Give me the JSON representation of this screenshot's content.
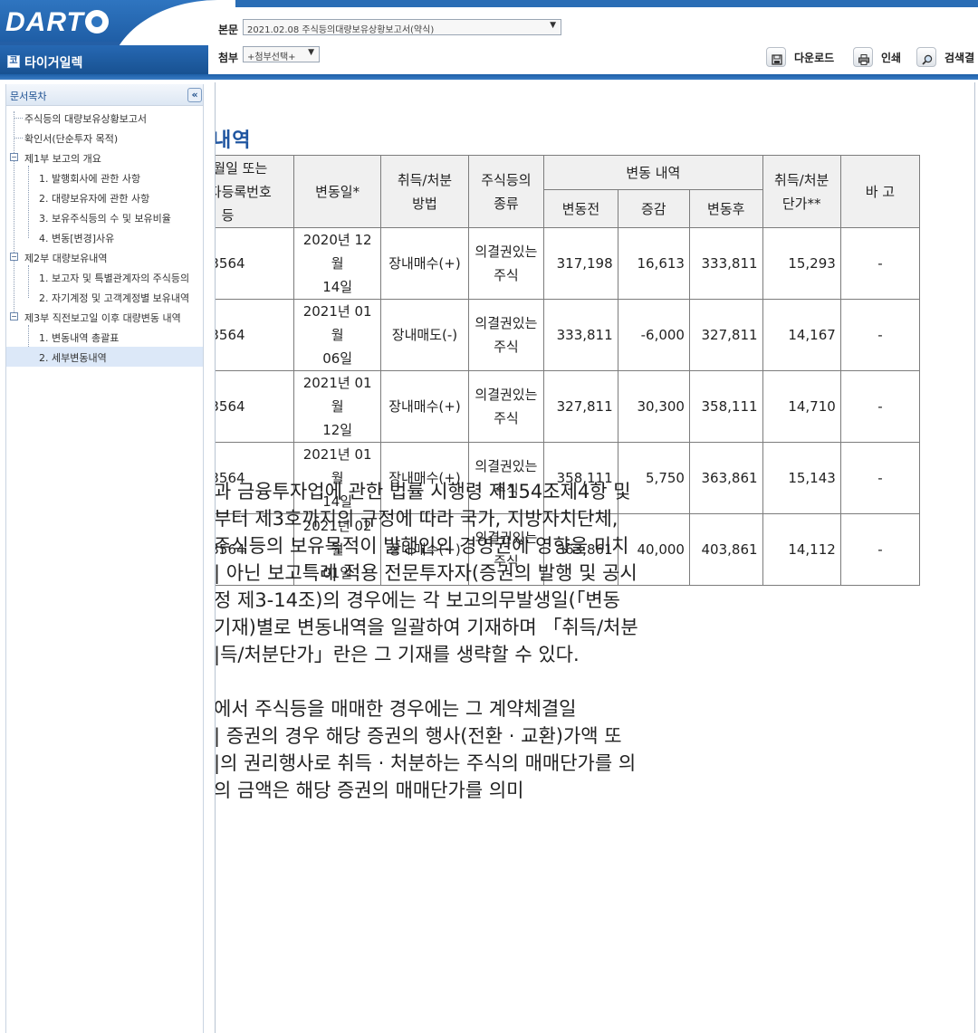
{
  "app": {
    "logo": "DART",
    "company": "타이거일렉",
    "company_icon": "코"
  },
  "header": {
    "body_label": "본문",
    "body_select": "2021.02.08 주식등의대량보유상황보고서(약식)",
    "attach_label": "첨부",
    "attach_select": "+첨부선택+",
    "download": "다운로드",
    "print": "인쇄",
    "search": "검색결"
  },
  "sidebar": {
    "title": "문서목차",
    "collapse": "«",
    "items": [
      {
        "label": "주식등의 대량보유상황보고서"
      },
      {
        "label": "확인서(단순투자 목적)"
      },
      {
        "label": "제1부 보고의 개요"
      },
      {
        "label": "1. 발행회사에 관한 사항"
      },
      {
        "label": "2. 대량보유자에 관한 사항"
      },
      {
        "label": "3. 보유주식등의 수 및 보유비율"
      },
      {
        "label": "4. 변동[변경]사유"
      },
      {
        "label": "제2부 대량보유내역"
      },
      {
        "label": "1. 보고자 및 특별관계자의 주식등의"
      },
      {
        "label": "2. 자기계정 및 고객계정별 보유내역"
      },
      {
        "label": "제3부 직전보고일 이후 대량변동 내역"
      },
      {
        "label": "1. 변동내역 총괄표"
      },
      {
        "label": "2. 세부변동내역"
      }
    ]
  },
  "content": {
    "section_title": "내역",
    "table": {
      "headers": {
        "col1": "생년월일 또는 사업자등록번호 등",
        "col1_lines": [
          "생년월일 또는",
          "사업자등록번호",
          "등"
        ],
        "change_date": "변동일*",
        "method": "취득/처분 방법",
        "method_lines": [
          "취득/처분",
          "방법"
        ],
        "stock_type": "주식등의 종류",
        "stock_type_lines": [
          "주식등의",
          "종류"
        ],
        "change_group": "변동 내역",
        "before": "변동전",
        "delta": "증감",
        "after": "변동후",
        "unit_price_lines": [
          "취득/처분",
          "단가**"
        ],
        "remark": "바 고"
      },
      "rows": [
        {
          "id": "3564",
          "date1": "2020년 12월",
          "date2": "14일",
          "method": "장내매수(+)",
          "type1": "의결권있는",
          "type2": "주식",
          "before": "317,198",
          "delta": "16,613",
          "after": "333,811",
          "price": "15,293",
          "remark": "-"
        },
        {
          "id": "3564",
          "date1": "2021년 01월",
          "date2": "06일",
          "method": "장내매도(-)",
          "type1": "의결권있는",
          "type2": "주식",
          "before": "333,811",
          "delta": "-6,000",
          "after": "327,811",
          "price": "14,167",
          "remark": "-"
        },
        {
          "id": "3564",
          "date1": "2021년 01월",
          "date2": "12일",
          "method": "장내매수(+)",
          "type1": "의결권있는",
          "type2": "주식",
          "before": "327,811",
          "delta": "30,300",
          "after": "358,111",
          "price": "14,710",
          "remark": "-"
        },
        {
          "id": "3564",
          "date1": "2021년 01월",
          "date2": "14일",
          "method": "장내매수(+)",
          "type1": "의결권있는",
          "type2": "주식",
          "before": "358,111",
          "delta": "5,750",
          "after": "363,861",
          "price": "15,143",
          "remark": "-"
        },
        {
          "id": "3564",
          "date1": "2021년 02월",
          "date2": "01일",
          "method": "장내매수(+)",
          "type1": "의결권있는",
          "type2": "주식",
          "before": "363,861",
          "delta": "40,000",
          "after": "403,861",
          "price": "14,112",
          "remark": "-"
        }
      ]
    },
    "notes": [
      "과 금융투자업에 관한 법률 시행령 제154조제4항 및",
      "부터 제3호까지의 규정에 따라 국가, 지방자치단체,",
      " 주식등의 보유목적이 발행인의 경영권에 영향을 미치",
      "| 아닌 보고특례 적용 전문투자자(증권의 발행 및 공시",
      "정 제3-14조)의 경우에는 각 보고의무발생일(「변동",
      "기재)별로 변동내역을 일괄하여 기재하며 「취득/처분",
      "|득/처분단가」란은 그 기재를 생략할 수 있다.",
      "에서 주식등을 매매한 경우에는 그 계약체결일",
      "| 증권의 경우 해당 증권의 행사(전환 · 교환)가액 또",
      "|의 권리행사로 취득 · 처분하는 주식의 매매단가를 의",
      "의 금액은 해당 증권의 매매단가를 의미"
    ]
  }
}
